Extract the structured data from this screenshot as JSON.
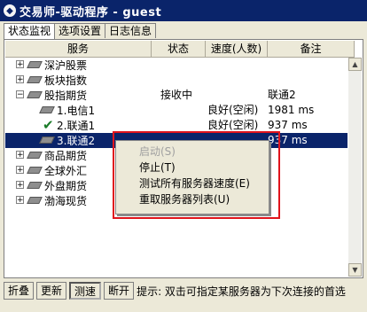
{
  "window": {
    "title": "交易师-驱动程序 - guest",
    "icon": "app-logo-icon"
  },
  "tabs": [
    {
      "label": "状态监视",
      "active": true
    },
    {
      "label": "选项设置",
      "active": false
    },
    {
      "label": "日志信息",
      "active": false
    }
  ],
  "table": {
    "columns": [
      "服务",
      "状态",
      "速度(人数)",
      "备注"
    ],
    "rows": [
      {
        "expander": "+",
        "icon": "server-icon",
        "label": "深沪股票",
        "status": "",
        "speed": "",
        "note": "",
        "level": 0
      },
      {
        "expander": "+",
        "icon": "server-icon",
        "label": "板块指数",
        "status": "",
        "speed": "",
        "note": "",
        "level": 0
      },
      {
        "expander": "−",
        "icon": "server-icon",
        "label": "股指期货",
        "status": "接收中",
        "speed": "",
        "note": "联通2",
        "level": 0
      },
      {
        "expander": "",
        "icon": "server-icon",
        "label": "1.电信1",
        "status": "",
        "speed": "良好(空闲)",
        "note": "1981 ms",
        "level": 1
      },
      {
        "expander": "",
        "icon": "check-icon",
        "label": "2.联通1",
        "status": "",
        "speed": "良好(空闲)",
        "note": "937 ms",
        "level": 1
      },
      {
        "expander": "",
        "icon": "server-icon",
        "label": "3.联通2",
        "status": "",
        "speed": "",
        "note": "937 ms",
        "level": 1,
        "selected": true
      },
      {
        "expander": "+",
        "icon": "server-icon",
        "label": "商品期货",
        "status": "",
        "speed": "",
        "note": "",
        "level": 0
      },
      {
        "expander": "+",
        "icon": "server-icon",
        "label": "全球外汇",
        "status": "",
        "speed": "",
        "note": "",
        "level": 0
      },
      {
        "expander": "+",
        "icon": "server-icon",
        "label": "外盘期货",
        "status": "",
        "speed": "",
        "note": "",
        "level": 0
      },
      {
        "expander": "+",
        "icon": "server-icon",
        "label": "渤海现货",
        "status": "",
        "speed": "",
        "note": "",
        "level": 0
      }
    ]
  },
  "context_menu": {
    "items": [
      {
        "label": "启动(S)",
        "disabled": true
      },
      {
        "label": "停止(T)",
        "disabled": false
      },
      {
        "label": "测试所有服务器速度(E)",
        "disabled": false
      },
      {
        "label": "重取服务器列表(U)",
        "disabled": false
      }
    ]
  },
  "buttons": {
    "collapse": "折叠",
    "refresh": "更新",
    "speedtest": "测速",
    "disconnect": "断开"
  },
  "hint": "提示: 双击可指定某服务器为下次连接的首选",
  "colors": {
    "selection": "#0a246a",
    "annotation_box": "#e0141c"
  }
}
